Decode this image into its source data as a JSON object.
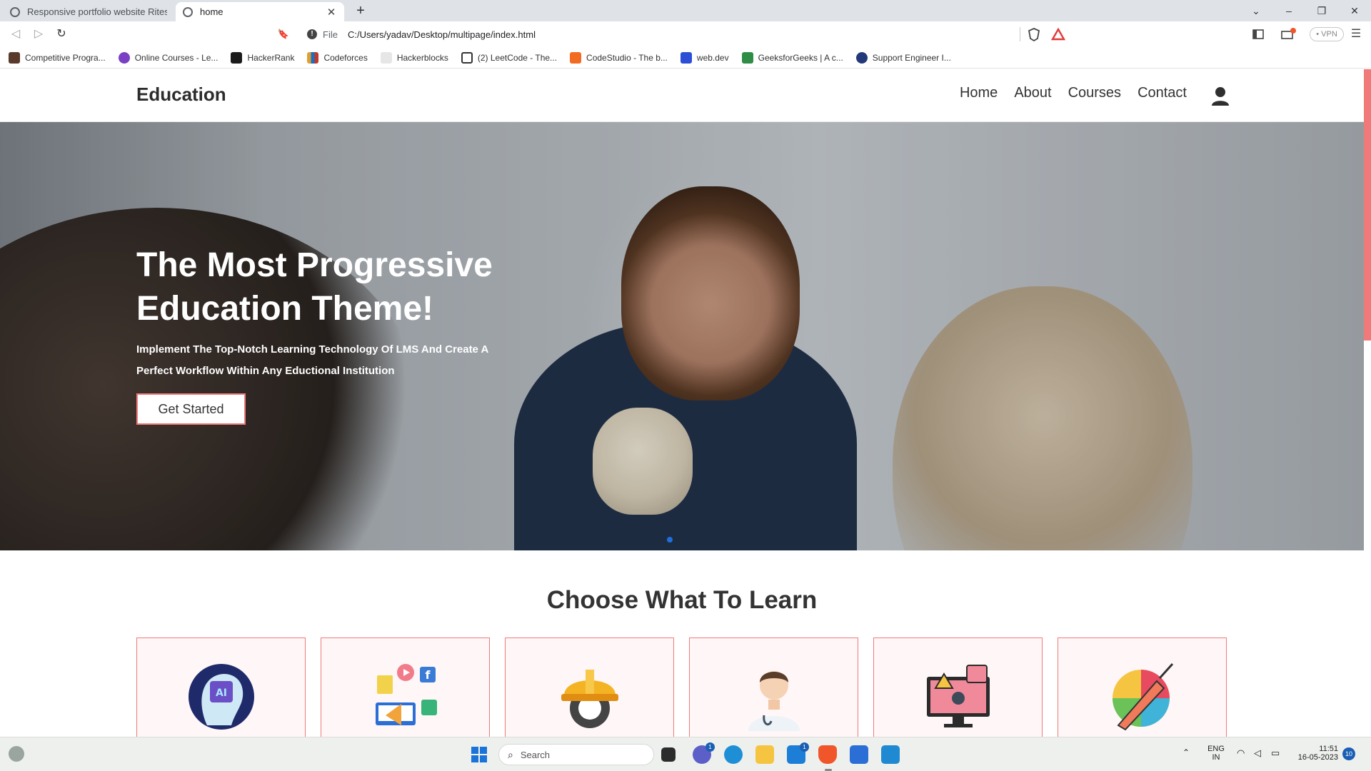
{
  "browser": {
    "tabs": [
      {
        "label": "Responsive portfolio website Ritesh"
      },
      {
        "label": "home"
      }
    ],
    "new_tab": "+",
    "window_controls": {
      "dropdown": "⌄",
      "minimize": "–",
      "restore": "❐",
      "close": "✕"
    },
    "nav": {
      "back": "◁",
      "forward": "▷",
      "reload": "↻",
      "bookmark": "🔖"
    },
    "url_scheme": "File",
    "url": "C:/Users/yadav/Desktop/multipage/index.html",
    "vpn_label": "• VPN",
    "bookmarks": [
      {
        "label": "Competitive Progra...",
        "color": "#5a3a2a"
      },
      {
        "label": "Online Courses - Le...",
        "color": "#7b3fc4"
      },
      {
        "label": "HackerRank",
        "color": "#1b1b1b"
      },
      {
        "label": "Codeforces",
        "color": "#e0a030"
      },
      {
        "label": "Hackerblocks",
        "color": "#e6e6e6"
      },
      {
        "label": "(2) LeetCode - The...",
        "color": "#333333"
      },
      {
        "label": "CodeStudio - The b...",
        "color": "#f26b21"
      },
      {
        "label": "web.dev",
        "color": "#2c4fd6"
      },
      {
        "label": "GeeksforGeeks | A c...",
        "color": "#2f8d46"
      },
      {
        "label": "Support Engineer I...",
        "color": "#233a7a"
      }
    ]
  },
  "site": {
    "brand": "Education",
    "menu": [
      {
        "label": "Home"
      },
      {
        "label": "About"
      },
      {
        "label": "Courses"
      },
      {
        "label": "Contact"
      }
    ],
    "hero": {
      "title": "The Most Progressive Education Theme!",
      "subtitle": "Implement The Top-Notch Learning Technology Of LMS And Create A Perfect Workflow Within Any Eductional Institution",
      "cta": "Get Started"
    },
    "section_title": "Choose What To Learn",
    "cards": [
      {
        "icon": "ai-brain-icon"
      },
      {
        "icon": "digital-marketing-icon"
      },
      {
        "icon": "engineering-helmet-gear-icon"
      },
      {
        "icon": "doctor-icon"
      },
      {
        "icon": "cyber-security-icon"
      },
      {
        "icon": "design-pen-icon"
      }
    ],
    "accent_color": "#f07a7a"
  },
  "taskbar": {
    "search_placeholder": "Search",
    "language": "ENG",
    "region": "IN",
    "time": "11:51",
    "date": "16-05-2023",
    "notification_count": "10",
    "teams_badge": "1",
    "mail_badge": "1"
  }
}
